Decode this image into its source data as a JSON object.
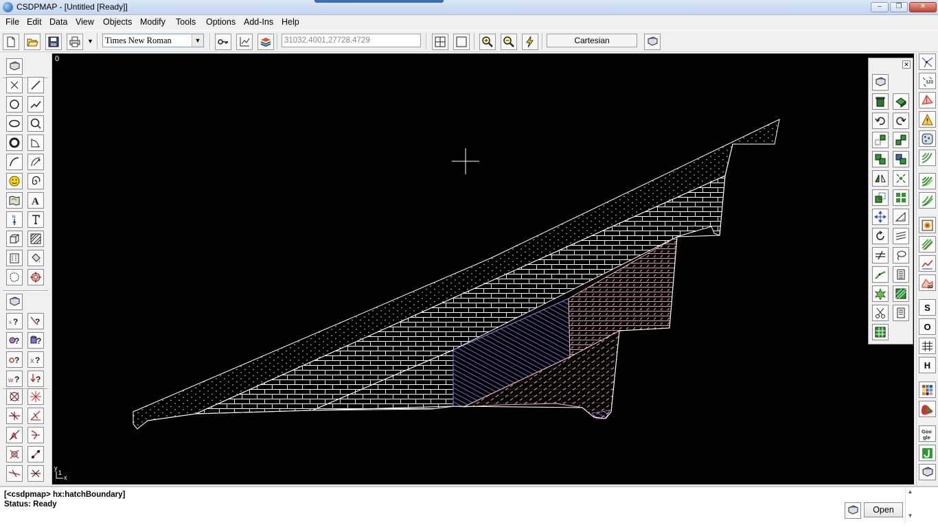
{
  "window": {
    "title": "CSDPMAP - [Untitled [Ready]]",
    "min_label": "–",
    "max_label": "❐",
    "close_label": "✕"
  },
  "menu": [
    "File",
    "Edit",
    "Data",
    "View",
    "Objects",
    "Modify",
    "Tools",
    "Options",
    "Add-Ins",
    "Help"
  ],
  "toolbar": {
    "font": "Times New Roman",
    "coordinates": "31032.4001,27728.4729",
    "coord_mode": "Cartesian"
  },
  "canvas": {
    "origin_label": "0",
    "axis_y": "y",
    "axis_x": "x",
    "axis_one": "1"
  },
  "command": {
    "line1": "[<csdpmap> hx:hatchBoundary]",
    "line2": "Status: Ready",
    "open_label": "Open"
  },
  "right_palette_letters": {
    "s": "S",
    "o": "O",
    "h": "H"
  },
  "colors": {
    "canvas_bg": "#000000",
    "outline": "#ffffff",
    "brick": "#ffffff",
    "pink_hatch": "#f2b8b0",
    "blue_hatch": "#7b7bdc"
  },
  "icons": [
    "new-icon",
    "open-icon",
    "save-icon",
    "print-icon",
    "key-icon",
    "axis-icon",
    "layers-icon",
    "grid-icon",
    "frame-icon",
    "zoom-in-icon",
    "zoom-out-icon",
    "lightning-icon",
    "book-icon"
  ]
}
